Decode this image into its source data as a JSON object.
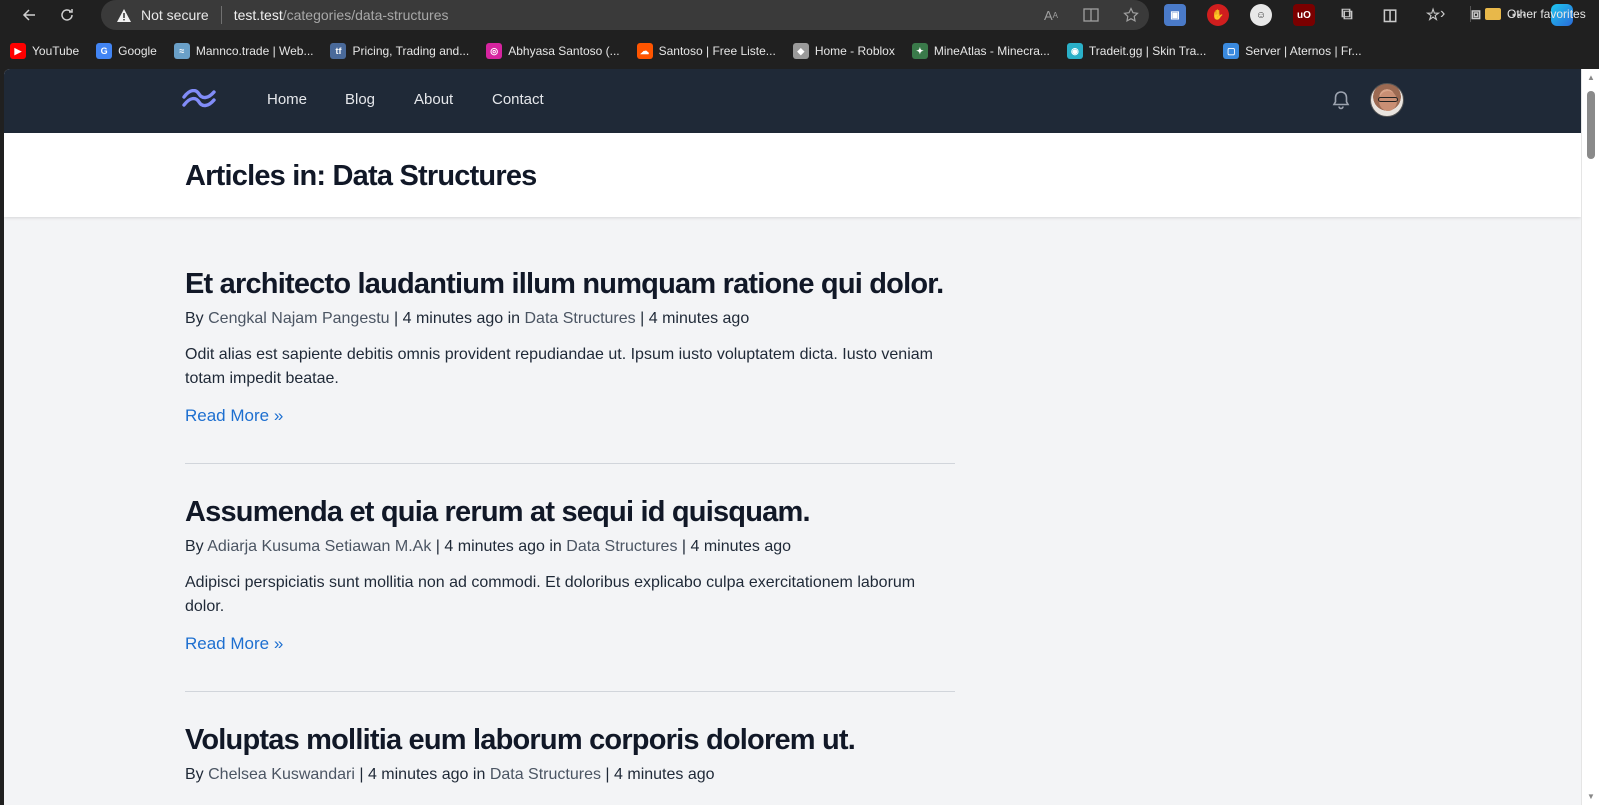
{
  "browser": {
    "security_label": "Not secure",
    "url_host": "test.test",
    "url_path": "/categories/data-structures",
    "bookmarks": [
      {
        "label": "YouTube",
        "icon": "youtube-icon",
        "color": "#ff0000"
      },
      {
        "label": "Google",
        "icon": "google-icon",
        "color": "#4285f4"
      },
      {
        "label": "Mannco.trade | Web...",
        "icon": "mannco-icon",
        "color": "#6aa0c8"
      },
      {
        "label": "Pricing, Trading and...",
        "icon": "tf-icon",
        "color": "#4a6a9a"
      },
      {
        "label": "Abhyasa Santoso (...",
        "icon": "instagram-icon",
        "color": "#d6249f"
      },
      {
        "label": "Santoso | Free Liste...",
        "icon": "soundcloud-icon",
        "color": "#ff5500"
      },
      {
        "label": "Home - Roblox",
        "icon": "roblox-icon",
        "color": "#9a9a9a"
      },
      {
        "label": "MineAtlas - Minecra...",
        "icon": "mineatlas-icon",
        "color": "#3a7a4a"
      },
      {
        "label": "Tradeit.gg | Skin Tra...",
        "icon": "tradeit-icon",
        "color": "#2ab0c8"
      },
      {
        "label": "Server | Aternos | Fr...",
        "icon": "aternos-icon",
        "color": "#3a8adf"
      }
    ],
    "other_favorites": "Other favorites"
  },
  "site": {
    "nav": [
      "Home",
      "Blog",
      "About",
      "Contact"
    ],
    "page_title": "Articles in: Data Structures",
    "read_more": "Read More »",
    "articles": [
      {
        "title": "Et architecto laudantium illum numquam ratione qui dolor.",
        "by": "By",
        "author": "Cengkal Najam Pangestu",
        "time": "4 minutes ago",
        "in": "in",
        "category": "Data Structures",
        "time2": "4 minutes ago",
        "excerpt": "Odit alias est sapiente debitis omnis provident repudiandae ut. Ipsum iusto voluptatem dicta. Iusto veniam totam impedit beatae."
      },
      {
        "title": "Assumenda et quia rerum at sequi id quisquam.",
        "by": "By",
        "author": "Adiarja Kusuma Setiawan M.Ak",
        "time": "4 minutes ago",
        "in": "in",
        "category": "Data Structures",
        "time2": "4 minutes ago",
        "excerpt": "Adipisci perspiciatis sunt mollitia non ad commodi. Et doloribus explicabo culpa exercitationem laborum dolor."
      },
      {
        "title": "Voluptas mollitia eum laborum corporis dolorem ut.",
        "by": "By",
        "author": "Chelsea Kuswandari",
        "time": "4 minutes ago",
        "in": "in",
        "category": "Data Structures",
        "time2": "4 minutes ago",
        "excerpt": ""
      }
    ]
  },
  "colors": {
    "nav_bg": "#1f2937",
    "page_bg": "#f3f4f6",
    "link_blue": "#1d6fd0",
    "logo_accent": "#818cf8"
  }
}
